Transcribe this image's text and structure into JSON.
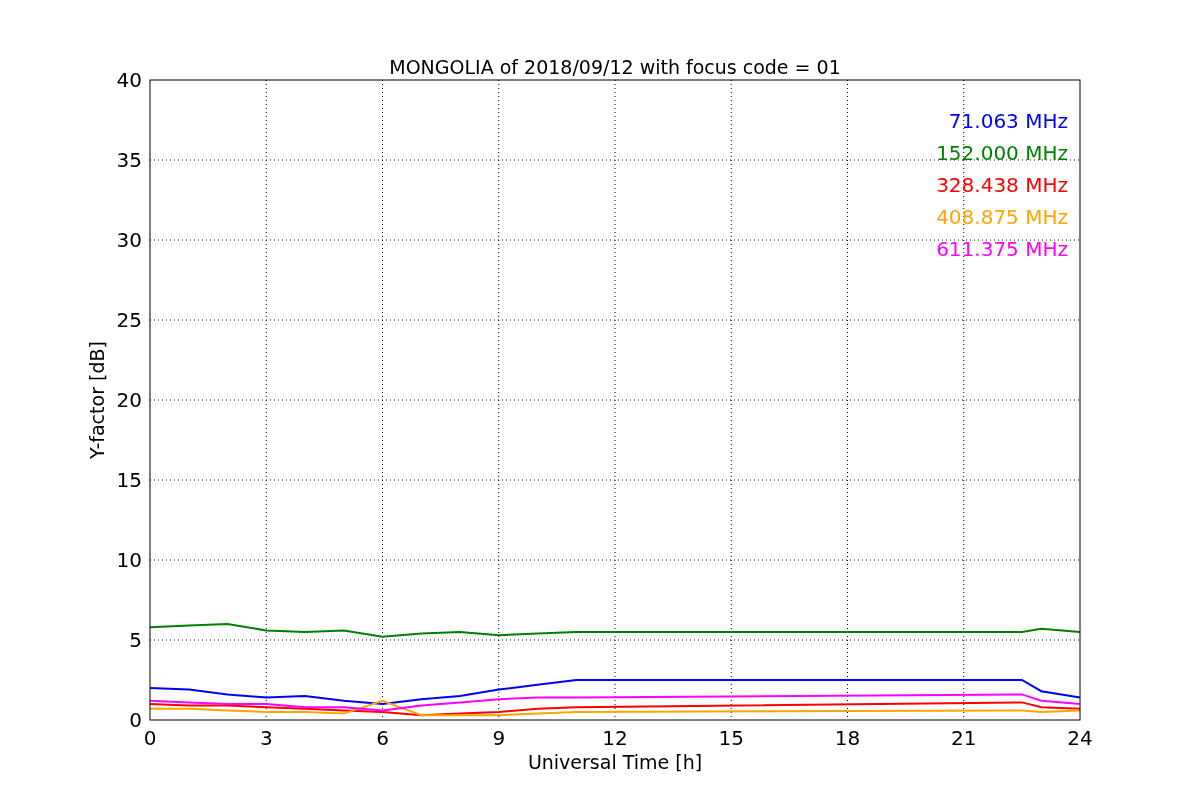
{
  "chart_data": {
    "type": "line",
    "title": "MONGOLIA of 2018/09/12 with focus code = 01",
    "xlabel": "Universal Time [h]",
    "ylabel": "Y-factor [dB]",
    "x": [
      0,
      1,
      2,
      3,
      4,
      5,
      6,
      7,
      8,
      9,
      10,
      11,
      22.5,
      23,
      24
    ],
    "series": [
      {
        "name": "71.063 MHz",
        "color": "#0000ff",
        "values": [
          2.0,
          1.9,
          1.6,
          1.4,
          1.5,
          1.2,
          1.0,
          1.3,
          1.5,
          1.9,
          2.2,
          2.5,
          2.5,
          1.8,
          1.4
        ]
      },
      {
        "name": "152.000 MHz",
        "color": "#008000",
        "values": [
          5.8,
          5.9,
          6.0,
          5.6,
          5.5,
          5.6,
          5.2,
          5.4,
          5.5,
          5.3,
          5.4,
          5.5,
          5.5,
          5.7,
          5.5
        ]
      },
      {
        "name": "328.438 MHz",
        "color": "#ff0000",
        "values": [
          1.0,
          0.9,
          0.9,
          0.8,
          0.7,
          0.6,
          0.5,
          0.3,
          0.4,
          0.5,
          0.7,
          0.8,
          1.1,
          0.8,
          0.7
        ]
      },
      {
        "name": "408.875 MHz",
        "color": "#ffa500",
        "values": [
          0.7,
          0.7,
          0.6,
          0.5,
          0.5,
          0.4,
          1.2,
          0.3,
          0.3,
          0.3,
          0.4,
          0.5,
          0.6,
          0.5,
          0.6
        ]
      },
      {
        "name": "611.375 MHz",
        "color": "#ff00ff",
        "values": [
          1.2,
          1.1,
          1.0,
          1.0,
          0.8,
          0.8,
          0.6,
          0.9,
          1.1,
          1.3,
          1.4,
          1.4,
          1.6,
          1.2,
          1.0
        ]
      }
    ],
    "xlim": [
      0,
      24
    ],
    "ylim": [
      0,
      40
    ],
    "xticks": [
      0,
      3,
      6,
      9,
      12,
      15,
      18,
      21,
      24
    ],
    "yticks": [
      0,
      5,
      10,
      15,
      20,
      25,
      30,
      35,
      40
    ],
    "grid": true
  }
}
